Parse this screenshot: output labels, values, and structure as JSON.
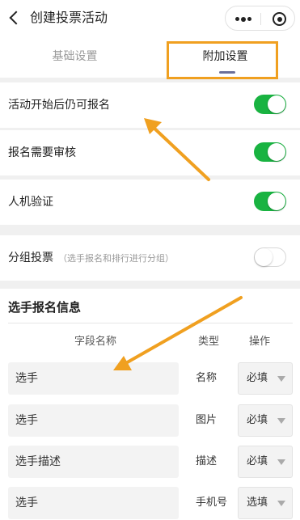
{
  "nav": {
    "title": "创建投票活动",
    "back_icon": "chevron-left-icon",
    "more_icon": "more-dots-icon",
    "close_icon": "target-circle-icon"
  },
  "tabs": [
    {
      "label": "基础设置",
      "active": false
    },
    {
      "label": "附加设置",
      "active": true
    }
  ],
  "settings": [
    {
      "label": "活动开始后仍可报名",
      "hint": "",
      "enabled": true
    },
    {
      "label": "报名需要审核",
      "hint": "",
      "enabled": true
    },
    {
      "label": "人机验证",
      "hint": "",
      "enabled": true
    },
    {
      "label": "分组投票",
      "hint": "（选手报名和排行进行分组）",
      "enabled": false
    }
  ],
  "player_info": {
    "title": "选手报名信息",
    "columns": {
      "name": "字段名称",
      "type": "类型",
      "op": "操作"
    },
    "rows": [
      {
        "name": "选手",
        "type": "名称",
        "op": "必填"
      },
      {
        "name": "选手",
        "type": "图片",
        "op": "必填"
      },
      {
        "name": "选手描述",
        "type": "描述",
        "op": "必填"
      },
      {
        "name": "选手",
        "type": "手机号",
        "op": "选填"
      }
    ]
  },
  "colors": {
    "switch_on": "#19b341",
    "highlight": "#f0a020",
    "tab_indicator": "#6b6f9a"
  }
}
